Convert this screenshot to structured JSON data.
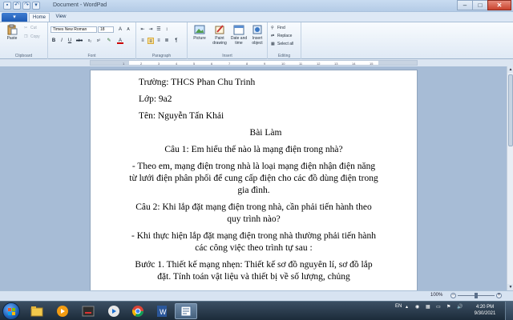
{
  "window": {
    "title": "Document - WordPad",
    "minimize": "–",
    "maximize": "□",
    "close": "✕"
  },
  "tabs": {
    "file": "▾",
    "home": "Home",
    "view": "View"
  },
  "ribbon": {
    "clipboard": {
      "paste": "Paste",
      "cut": "Cut",
      "copy": "Copy",
      "label": "Clipboard"
    },
    "font": {
      "family": "Times New Roman",
      "size": "18",
      "label": "Font",
      "bold": "B",
      "italic": "I",
      "underline": "U",
      "strike": "abc",
      "subscript": "x₂",
      "superscript": "x²"
    },
    "paragraph": {
      "label": "Paragraph"
    },
    "insert": {
      "picture": "Picture",
      "paint": "Paint drawing",
      "datetime": "Date and time",
      "object": "Insert object",
      "label": "Insert"
    },
    "editing": {
      "find": "Find",
      "replace": "Replace",
      "select_all": "Select all",
      "label": "Editing"
    }
  },
  "ruler": {
    "ticks": [
      "1",
      "2",
      "3",
      "4",
      "5",
      "6",
      "7",
      "8",
      "9",
      "10",
      "11",
      "12",
      "13",
      "14",
      "15"
    ]
  },
  "document": {
    "lines": [
      {
        "text": "Trường: THCS Phan Chu Trinh",
        "align": "left"
      },
      {
        "text": "Lớp: 9a2",
        "align": "left"
      },
      {
        "text": "Tên: Nguyễn Tấn Khải",
        "align": "left"
      },
      {
        "text": "Bài Làm",
        "align": "heading"
      },
      {
        "text": "Câu 1: Em hiểu thế nào là mạng điện trong nhà?",
        "align": "center"
      },
      {
        "text": "- Theo em, mạng điện trong nhà là loại mạng điện nhận điện năng từ lưới điện phân phối để cung cấp điện cho các đồ dùng điện trong gia đình.",
        "align": "center"
      },
      {
        "text": "Câu 2: Khi lắp đặt mạng điện trong nhà, cần phải tiến hành theo quy trình nào?",
        "align": "center"
      },
      {
        "text": "- Khi thực hiện lắp đặt mạng điện trong nhà thường phải tiến hành các công việc theo trình tự sau :",
        "align": "center"
      },
      {
        "text": "Bước 1. Thiết kế mạng nhẹn: Thiết kế sơ đồ nguyên lí, sơ đồ lắp đặt. Tính toán vật liệu và thiết bị về số lượng, chủng",
        "align": "center"
      }
    ]
  },
  "status": {
    "zoom": "100%",
    "zoom_level": 1.0
  },
  "taskbar": {
    "apps": [
      "Windows Explorer",
      "Media Player",
      "Chrome",
      "Word",
      "WordPad"
    ],
    "language": "EN",
    "time": "4:20 PM",
    "date": "9/30/2021"
  },
  "colors": {
    "ribbon_bg": "#dfe9f5",
    "file_tab": "#1d5bb5",
    "doc_bg": "#a7bcd6",
    "taskbar": "#1c2b3a"
  }
}
